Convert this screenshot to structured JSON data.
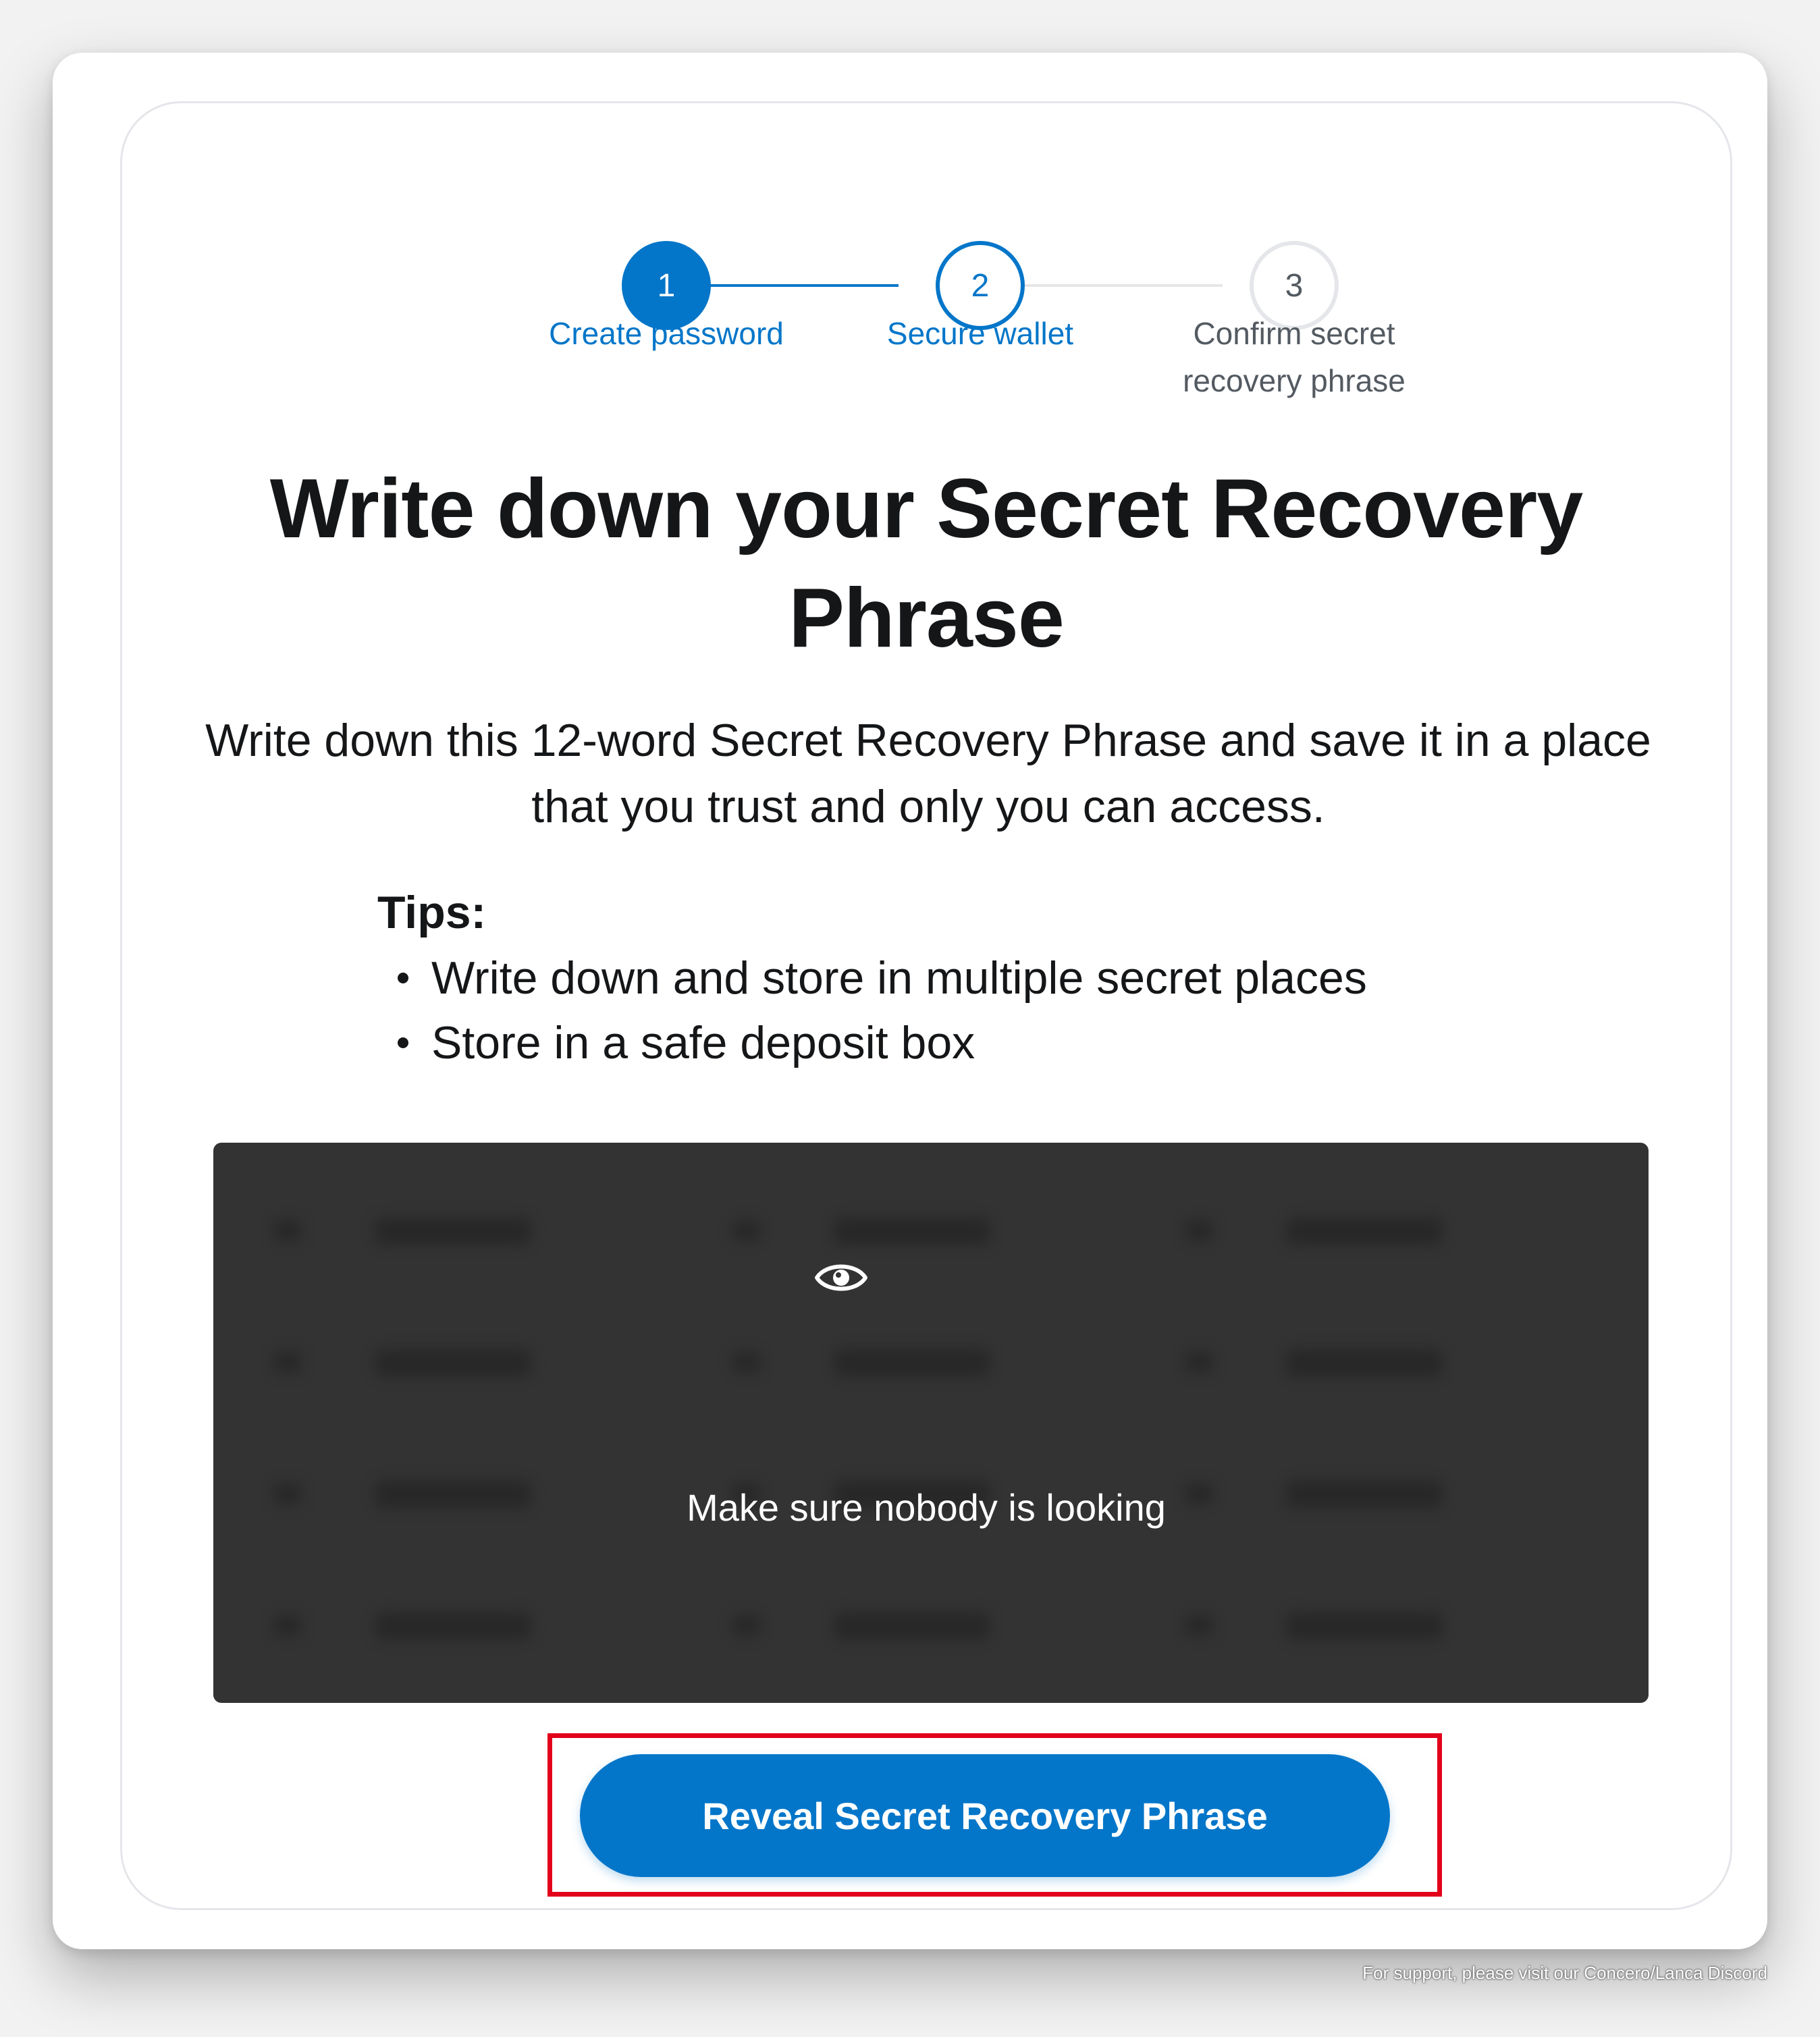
{
  "stepper": {
    "steps": [
      {
        "number": "1",
        "label": "Create password",
        "state": "complete"
      },
      {
        "number": "2",
        "label": "Secure wallet",
        "state": "active"
      },
      {
        "number": "3",
        "label": "Confirm secret recovery phrase",
        "state": "upcoming"
      }
    ],
    "colors": {
      "active": "#0376c9",
      "inactive": "#535a61"
    }
  },
  "title": "Write down your Secret Recovery Phrase",
  "description": "Write down this 12-word Secret Recovery Phrase and save it in a place that you trust and only you can access.",
  "tips": {
    "heading": "Tips:",
    "items": [
      "Write down and store in multiple secret places",
      "Store in a safe deposit box"
    ]
  },
  "phrase_box": {
    "icon": "eye-icon",
    "message": "Make sure nobody is looking",
    "blurred": true
  },
  "reveal_button": {
    "label": "Reveal Secret Recovery Phrase",
    "color": "#0376c9"
  },
  "highlight_color": "#e2001a",
  "footer": {
    "support_text": "For support, please visit our Concero/Lanca Discord"
  }
}
